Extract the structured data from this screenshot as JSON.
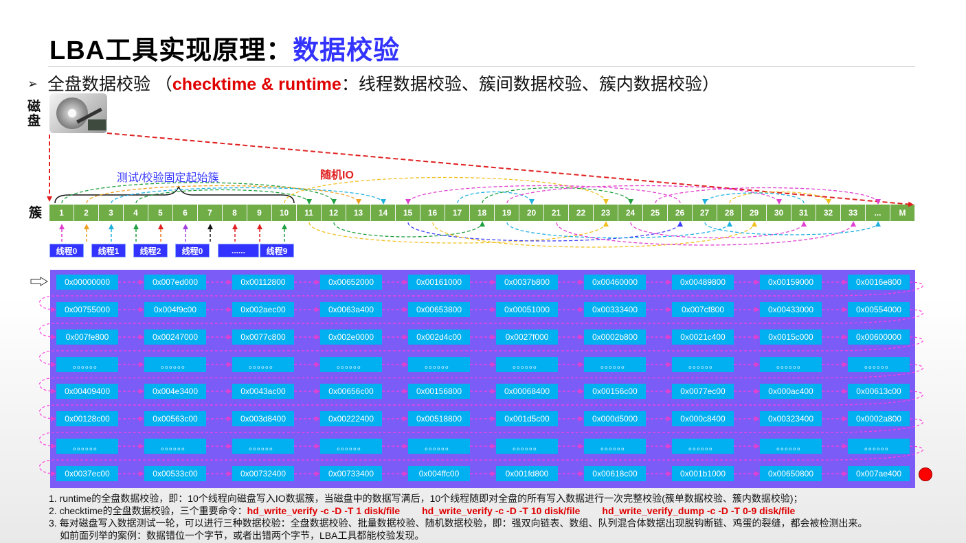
{
  "title": {
    "main": "LBA工具实现原理：",
    "highlight": "数据校验"
  },
  "subtitle": {
    "bullet": "➢",
    "lead": "全盘数据校验 （",
    "red": "checktime & runtime",
    "tail": "：线程数据校验、簇间数据校验、簇内数据校验）"
  },
  "disk_label": [
    "磁",
    "盘"
  ],
  "cluster_label": "簇",
  "labels": {
    "fixed_start": "测试/校验固定起始簇",
    "random_io": "随机IO"
  },
  "clusters": [
    "1",
    "2",
    "3",
    "4",
    "5",
    "6",
    "7",
    "8",
    "9",
    "10",
    "11",
    "12",
    "13",
    "14",
    "15",
    "16",
    "17",
    "18",
    "19",
    "20",
    "21",
    "22",
    "23",
    "24",
    "25",
    "26",
    "27",
    "28",
    "29",
    "30",
    "31",
    "32",
    "33",
    "...",
    "M"
  ],
  "threads": [
    "线程0",
    "线程1",
    "线程2",
    "线程0",
    "......",
    "线程9"
  ],
  "addresses": [
    [
      "0x00000000",
      "0x007ed000",
      "0x00112800",
      "0x00652000",
      "0x00161000",
      "0x0037b800",
      "0x00460000",
      "0x00489800",
      "0x00159000",
      "0x0016e800"
    ],
    [
      "0x00755000",
      "0x004f9c00",
      "0x002aec00",
      "0x0063a400",
      "0x00653800",
      "0x00051000",
      "0x00333400",
      "0x007cf800",
      "0x00433000",
      "0x00554000"
    ],
    [
      "0x007fe800",
      "0x00247000",
      "0x0077c800",
      "0x002e0000",
      "0x002d4c00",
      "0x0027f000",
      "0x0002b800",
      "0x0021c400",
      "0x0015c000",
      "0x00600000"
    ],
    [
      "。。。。。。",
      "。。。。。。",
      "。。。。。。",
      "。。。。。。",
      "。。。。。。",
      "。。。。。。",
      "。。。。。。",
      "。。。。。。",
      "。。。。。。",
      "。。。。。。"
    ],
    [
      "0x00409400",
      "0x004e3400",
      "0x0043ac00",
      "0x00656c00",
      "0x00156800",
      "0x00068400",
      "0x00156c00",
      "0x0077ec00",
      "0x000ac400",
      "0x00613c00"
    ],
    [
      "0x00128c00",
      "0x00563c00",
      "0x003d8400",
      "0x00222400",
      "0x00518800",
      "0x001d5c00",
      "0x000d5000",
      "0x000c8400",
      "0x00323400",
      "0x0002a800"
    ],
    [
      "。。。。。。",
      "。。。。。。",
      "。。。。。。",
      "。。。。。。",
      "。。。。。。",
      "。。。。。。",
      "。。。。。。",
      "。。。。。。",
      "。。。。。。",
      "。。。。。。"
    ],
    [
      "0x0037ec00",
      "0x00533c00",
      "0x00732400",
      "0x00733400",
      "0x004ffc00",
      "0x001fd800",
      "0x00618c00",
      "0x001b1000",
      "0x00650800",
      "0x007ae400"
    ]
  ],
  "notes": {
    "line1": "1. runtime的全盘数据校验，即：10个线程向磁盘写入IO数据簇，当磁盘中的数据写满后，10个线程随即对全盘的所有写入数据进行一次完整校验(簇单数据校验、簇内数据校验)；",
    "line2_lead": "2. checktime的全盘数据校验，三个重要命令：",
    "cmd1": "hd_write_verify -c -D -T 1 disk/file",
    "cmd2": "hd_write_verify -c -D -T 10 disk/file",
    "cmd3": "hd_write_verify_dump -c -D -T 0-9 disk/file",
    "line3": "3. 每对磁盘写入数据测试一轮，可以进行三种数据校验：全盘数据校验、批量数据校验、随机数据校验，即：强双向链表、数组、队列混合体数据出现脱钩断链、鸡蛋的裂缝，都会被检测出来。",
    "line4": "如前面列举的案例：数据错位一个字节，或者出错两个字节，LBA工具都能校验发现。"
  },
  "colors": {
    "cluster_green": "#70ad47",
    "thread_blue": "#3333ff",
    "panel_purple": "#7b5cf6",
    "cell_cyan": "#00b0f0",
    "accent_red": "#e00000"
  }
}
